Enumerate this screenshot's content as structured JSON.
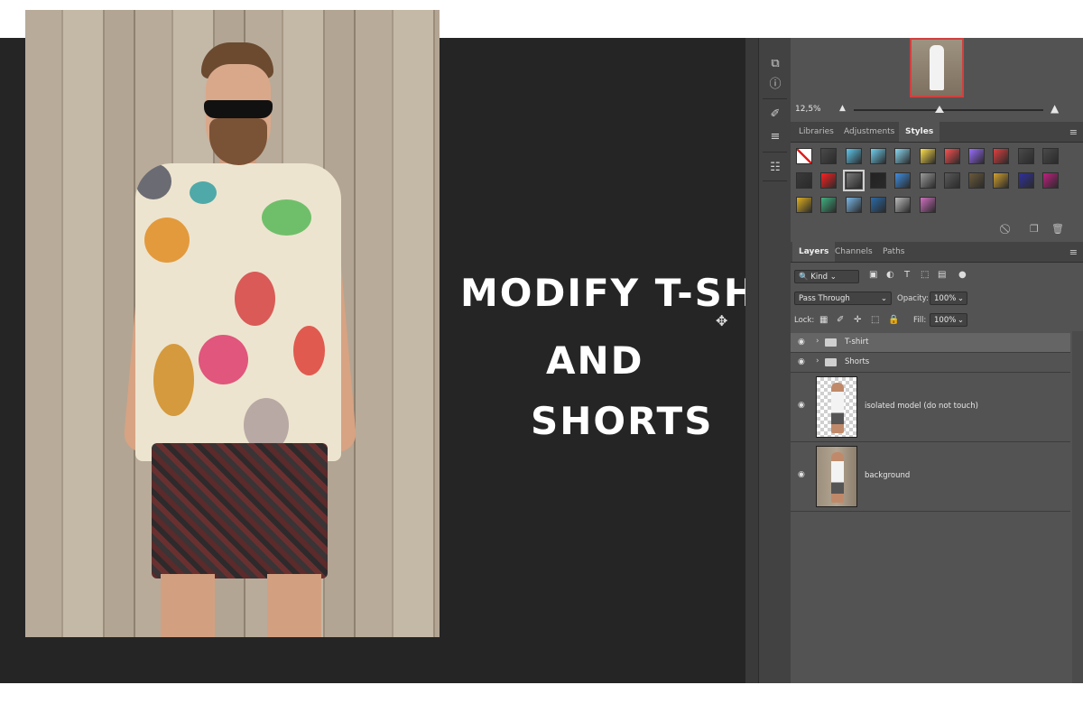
{
  "headline": {
    "line1": "MODIFY T-SHIRT",
    "line2": "AND",
    "line3": "SHORTS"
  },
  "navigator": {
    "zoom": "12,5%",
    "zoom_slider_fraction": 0.45
  },
  "styles_panel": {
    "tabs": [
      "Libraries",
      "Adjustments",
      "Styles"
    ],
    "active_tab": "Styles",
    "swatch_colors": [
      [
        "#ffffff",
        "#4a4a4a",
        "#5ec8ee",
        "#6fd0f0",
        "#8ad8f2",
        "#ffe04a",
        "#ff5050",
        "#9a6cff",
        "#e04040",
        "#4a4a4a",
        "#4a4a4a"
      ],
      [
        "#3a3a3a",
        "#ff2020",
        "#7a7a7a",
        "#222222",
        "#3f8ee0",
        "#9a9a9a",
        "#5a5a5a",
        "#6b5a3a",
        "#d0a030",
        "#3030a0",
        "#c02080"
      ],
      [
        "#e0b020",
        "#40b080",
        "#7ab8e8",
        "#2a6aa8",
        "#bcbcbc",
        "#d070c0"
      ]
    ]
  },
  "layers_panel": {
    "tabs": [
      "Layers",
      "Channels",
      "Paths"
    ],
    "active_tab": "Layers",
    "filter_kind": "Kind",
    "blend_mode": "Pass Through",
    "opacity_label": "Opacity:",
    "opacity_value": "100%",
    "lock_label": "Lock:",
    "fill_label": "Fill:",
    "fill_value": "100%",
    "layers": [
      {
        "name": "T-shirt",
        "type": "group"
      },
      {
        "name": "Shorts",
        "type": "group"
      },
      {
        "name": "isolated model (do not touch)",
        "type": "layer"
      },
      {
        "name": "background",
        "type": "layer"
      }
    ]
  }
}
